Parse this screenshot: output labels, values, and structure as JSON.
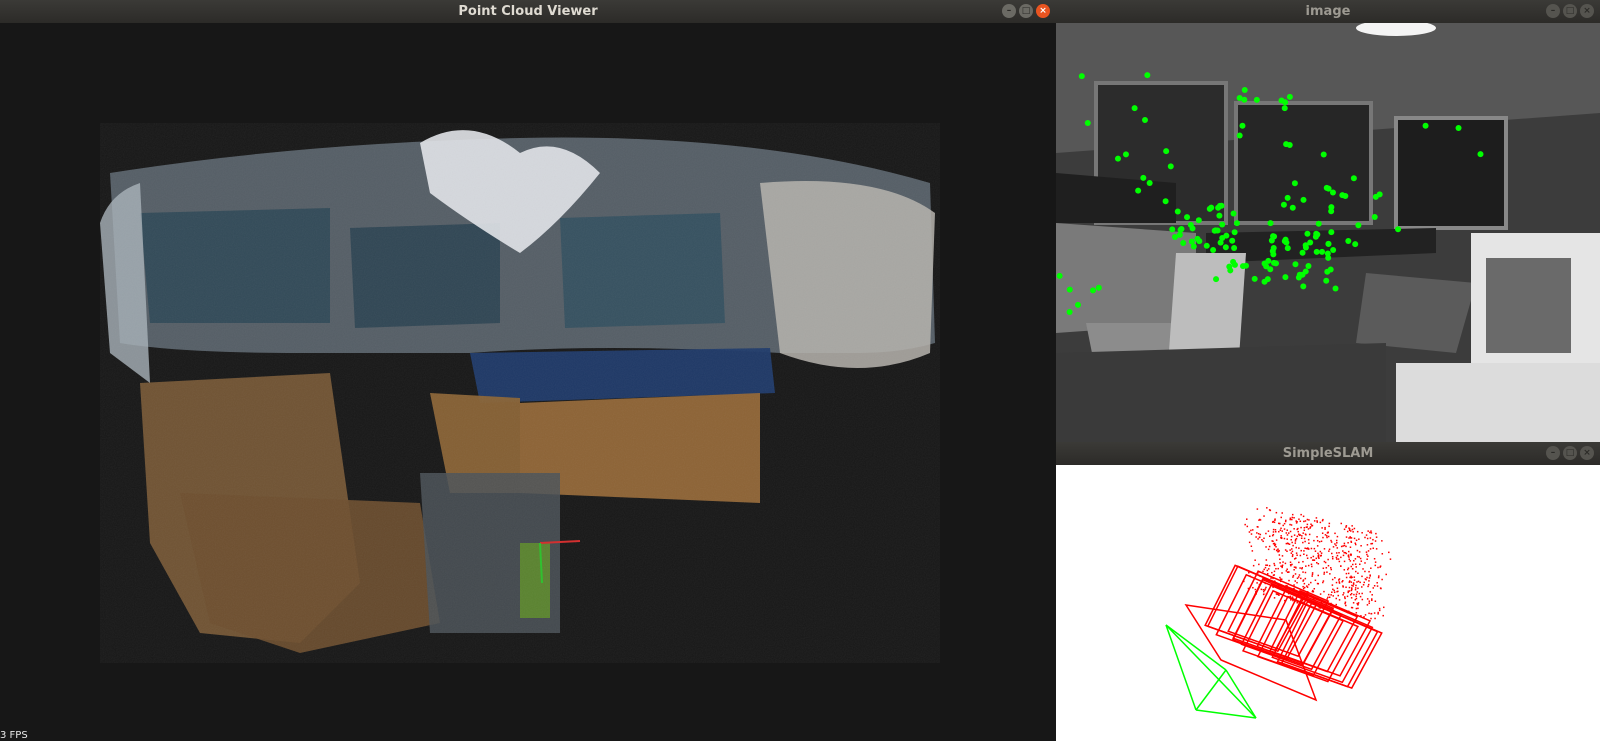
{
  "windows": {
    "point_cloud": {
      "title": "Point Cloud Viewer",
      "fps_text": "3 FPS"
    },
    "image": {
      "title": "image"
    },
    "slam": {
      "title": "SimpleSLAM"
    }
  },
  "window_buttons": {
    "minimize": "–",
    "maximize": "□",
    "close": "×"
  },
  "colors": {
    "feature_points": "#00ff00",
    "map_points": "#ff0000",
    "trajectory": "#ff0000",
    "current_camera": "#00ff00",
    "titlebar_close": "#e95420"
  }
}
